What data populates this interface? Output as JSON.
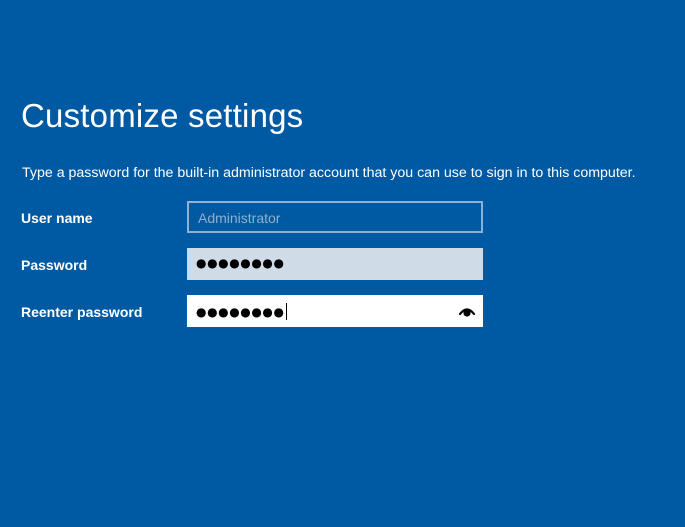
{
  "header": {
    "title": "Customize settings",
    "description": "Type a password for the built-in administrator account that you can use to sign in to this computer."
  },
  "form": {
    "username": {
      "label": "User name",
      "value": "Administrator"
    },
    "password": {
      "label": "Password",
      "value_masked": "●●●●●●●●"
    },
    "reenter_password": {
      "label": "Reenter password",
      "value_masked": "●●●●●●●●",
      "reveal_icon": "eye-icon"
    }
  },
  "colors": {
    "background": "#0059a3",
    "text": "#ffffff",
    "disabled_border": "#8fb0cf",
    "password_field_bg": "#cfdbe6",
    "focused_field_bg": "#ffffff"
  }
}
